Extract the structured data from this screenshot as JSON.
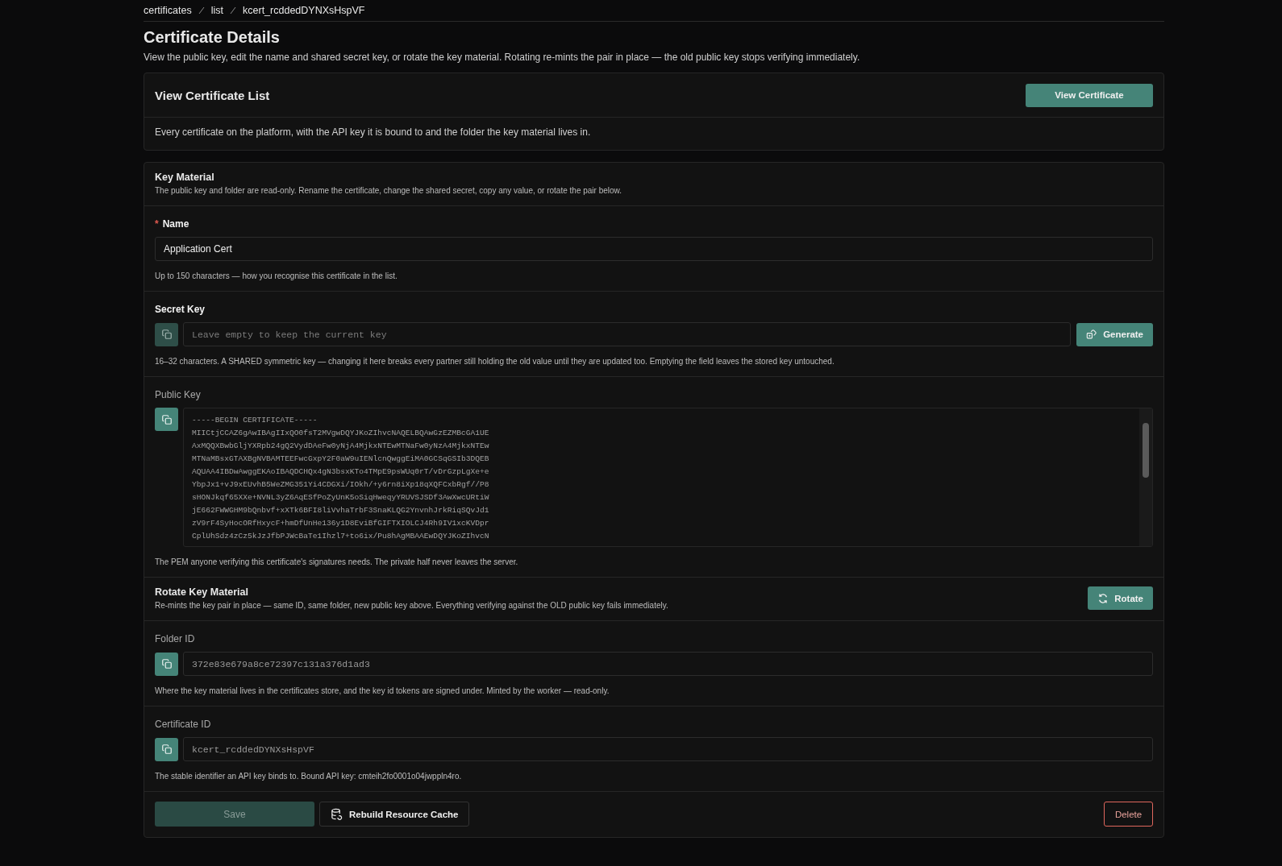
{
  "breadcrumb": [
    {
      "label": "certificates"
    },
    {
      "label": "list"
    },
    {
      "label": "kcert_rcddedDYNXsHspVF"
    }
  ],
  "page": {
    "title": "Certificate Details",
    "description": "View the public key, edit the name and shared secret key, or rotate the key material. Rotating re-mints the pair in place — the old public key stops verifying immediately."
  },
  "list_card": {
    "title": "View Certificate List",
    "button": "View Certificate",
    "description": "Every certificate on the platform, with the API key it is bound to and the folder the key material lives in."
  },
  "key_material": {
    "title": "Key Material",
    "description": "The public key and folder are read-only. Rename the certificate, change the shared secret, copy any value, or rotate the pair below.",
    "sections": [
      {
        "kind": "text",
        "label": "Name",
        "marker": "*",
        "value": "Application Cert",
        "help": "Up to 150 characters — how you recognise this certificate in the list."
      },
      {
        "kind": "secret",
        "label": "Secret Key",
        "placeholder": "Leave empty to keep the current key",
        "button": "Generate",
        "help": "16–32 characters. A SHARED symmetric key — changing it here breaks every partner still holding the old value until they are updated too. Emptying the field leaves the stored key untouched."
      },
      {
        "kind": "pem",
        "label": "Public Key",
        "lines": [
          "-----BEGIN CERTIFICATE-----",
          "MIICtjCCAZ6gAwIBAgIIxQO0fsT2MVgwDQYJKoZIhvcNAQELBQAwGzEZMBcGA1UE",
          "AxMQQXBwbGljYXRpb24gQ2VydDAeFw0yNjA4MjkxNTEwMTNaFw0yNzA4MjkxNTEw",
          "MTNaMBsxGTAXBgNVBAMTEEFwcGxpY2F0aW9uIENlcnQwggEiMA0GCSqGSIb3DQEB",
          "AQUAA4IBDwAwggEKAoIBAQDCHQx4gN3bsxKTo4TMpE9psWUq0rT/vDrGzpLgXe+e",
          "YbpJx1+vJ9xEUvhB5WeZMG351Yi4CDGXi/IOkh/+y6rn8iXp18qXQFCxbRgf//P8",
          "sHONJkqf65XXe+NVNL3yZ6AqESfPoZyUnK5oSiqHweqyYRUVSJSDf3AwXwcURtiW",
          "jE662FWWGHM9bQnbvf+xXTk6BFI8liVvhaTrbF3SnaKLQG2YnvnhJrkRiqSQvJd1",
          "zV9rF4SyHocORfHxycF+hmDfUnHe136y1D8EviBfGIFTXIOLCJ4Rh9IV1xcKVDpr",
          "CplUhSdz4zCz5kJzJfbPJWcBaTe1Ihzl7+to6ix/Pu8hAgMBAAEwDQYJKoZIhvcN"
        ],
        "help": "The PEM anyone verifying this certificate's signatures needs. The private half never leaves the server."
      },
      {
        "kind": "action",
        "title": "Rotate Key Material",
        "description": "Re-mints the key pair in place — same ID, same folder, new public key above. Everything verifying against the OLD public key fails immediately.",
        "button": "Rotate"
      },
      {
        "kind": "readonly",
        "label": "Folder ID",
        "value": "372e83e679a8ce72397c131a376d1ad3",
        "help": "Where the key material lives in the certificates store, and the key id tokens are signed under. Minted by the worker — read-only."
      },
      {
        "kind": "readonly",
        "label": "Certificate ID",
        "value": "kcert_rcddedDYNXsHspVF",
        "help": "The stable identifier an API key binds to. Bound API key: cmteih2fo0001o04jwppln4ro."
      }
    ]
  },
  "footer": {
    "save": {
      "label": "Save",
      "disabled": true
    },
    "rebuild": "Rebuild Resource Cache",
    "delete": "Delete"
  }
}
